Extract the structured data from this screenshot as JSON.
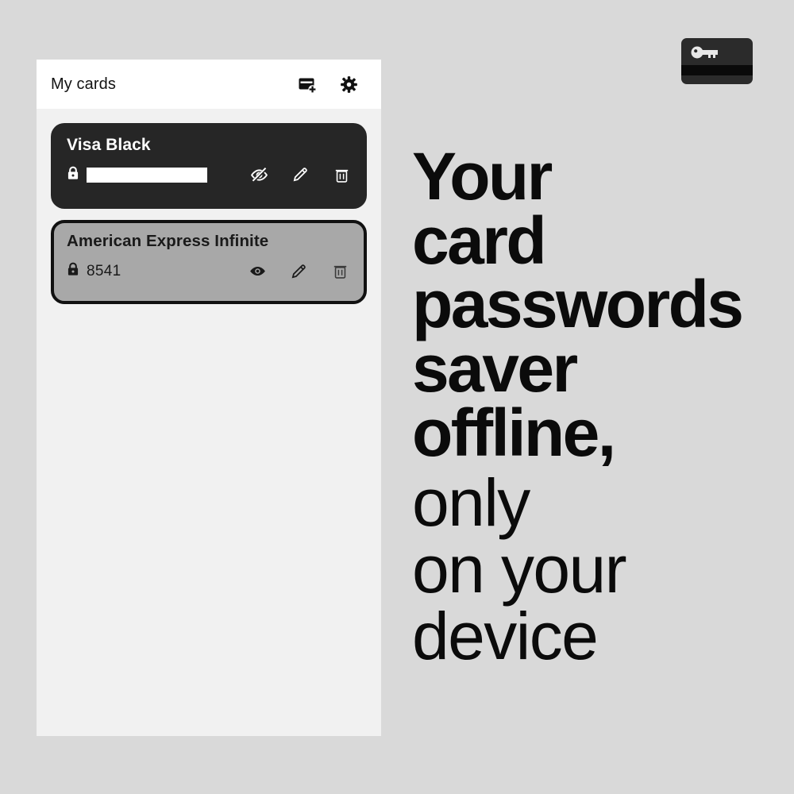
{
  "theme": {
    "page_background": "#d9d9d9",
    "panel_background": "#f1f1f1",
    "appbar_background": "#ffffff",
    "card_dark": "#262626",
    "card_selected": "#a8a8a8",
    "card_selected_border": "#111111",
    "text_primary": "#0b0b0b"
  },
  "app_icon": {
    "name": "card-key-app-icon",
    "glyph": "key-icon",
    "background": "#2b2b2b",
    "stripe_color": "#0a0a0a"
  },
  "phone": {
    "appbar": {
      "title": "My cards",
      "actions": [
        {
          "name": "add-card-button",
          "icon": "add-card-icon",
          "label": "Add card"
        },
        {
          "name": "settings-button",
          "icon": "gear-icon",
          "label": "Settings"
        }
      ]
    },
    "cards": [
      {
        "title": "Visa Black",
        "theme": "dark",
        "secret_hidden": true,
        "secret_value": "",
        "lock_icon": "lock-icon",
        "actions": [
          {
            "name": "toggle-visibility-button",
            "icon": "eye-off-icon",
            "label": "Show password"
          },
          {
            "name": "edit-card-button",
            "icon": "pencil-icon",
            "label": "Edit"
          },
          {
            "name": "delete-card-button",
            "icon": "trash-icon",
            "label": "Delete"
          }
        ]
      },
      {
        "title": "American Express Infinite",
        "theme": "selected",
        "secret_hidden": false,
        "secret_value": "8541",
        "lock_icon": "lock-icon",
        "actions": [
          {
            "name": "toggle-visibility-button",
            "icon": "eye-icon",
            "label": "Hide password"
          },
          {
            "name": "edit-card-button",
            "icon": "pencil-icon",
            "label": "Edit"
          },
          {
            "name": "delete-card-button",
            "icon": "trash-icon",
            "label": "Delete"
          }
        ]
      }
    ]
  },
  "marketing": {
    "lines_bold": [
      "Your",
      "card",
      "passwords",
      "saver",
      "offline,"
    ],
    "lines_light": [
      "only",
      "on your",
      "device"
    ]
  }
}
